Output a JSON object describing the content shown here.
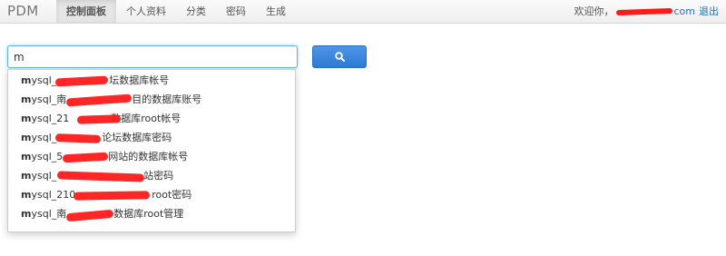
{
  "app": {
    "brand": "PDM"
  },
  "nav": {
    "items": [
      {
        "label": "控制面板"
      },
      {
        "label": "个人资料"
      },
      {
        "label": "分类"
      },
      {
        "label": "密码"
      },
      {
        "label": "生成"
      }
    ]
  },
  "user": {
    "greeting": "欢迎你，",
    "email_suffix": "com",
    "logout": "退出"
  },
  "search": {
    "value": "m"
  },
  "suggestions": [
    {
      "match": "m",
      "rest": "ysql_",
      "tail": "坛数据库帐号"
    },
    {
      "match": "m",
      "rest": "ysql_南",
      "tail": "目的数据库账号"
    },
    {
      "match": "m",
      "rest": "ysql_21",
      "tail": "数据库root帐号"
    },
    {
      "match": "m",
      "rest": "ysql_",
      "tail": "论坛数据库密码"
    },
    {
      "match": "m",
      "rest": "ysql_5",
      "tail": "网站的数据库帐号"
    },
    {
      "match": "m",
      "rest": "ysql_",
      "tail": "站密码"
    },
    {
      "match": "m",
      "rest": "ysql_210",
      "tail": "root密码"
    },
    {
      "match": "m",
      "rest": "ysql_南",
      "tail": "数据库root管理"
    }
  ],
  "colors": {
    "redaction": "#ff1a1a",
    "search_button": "#2d7bd6",
    "focus_border": "#66afe9"
  },
  "icons": {
    "search_button": "search-icon"
  }
}
